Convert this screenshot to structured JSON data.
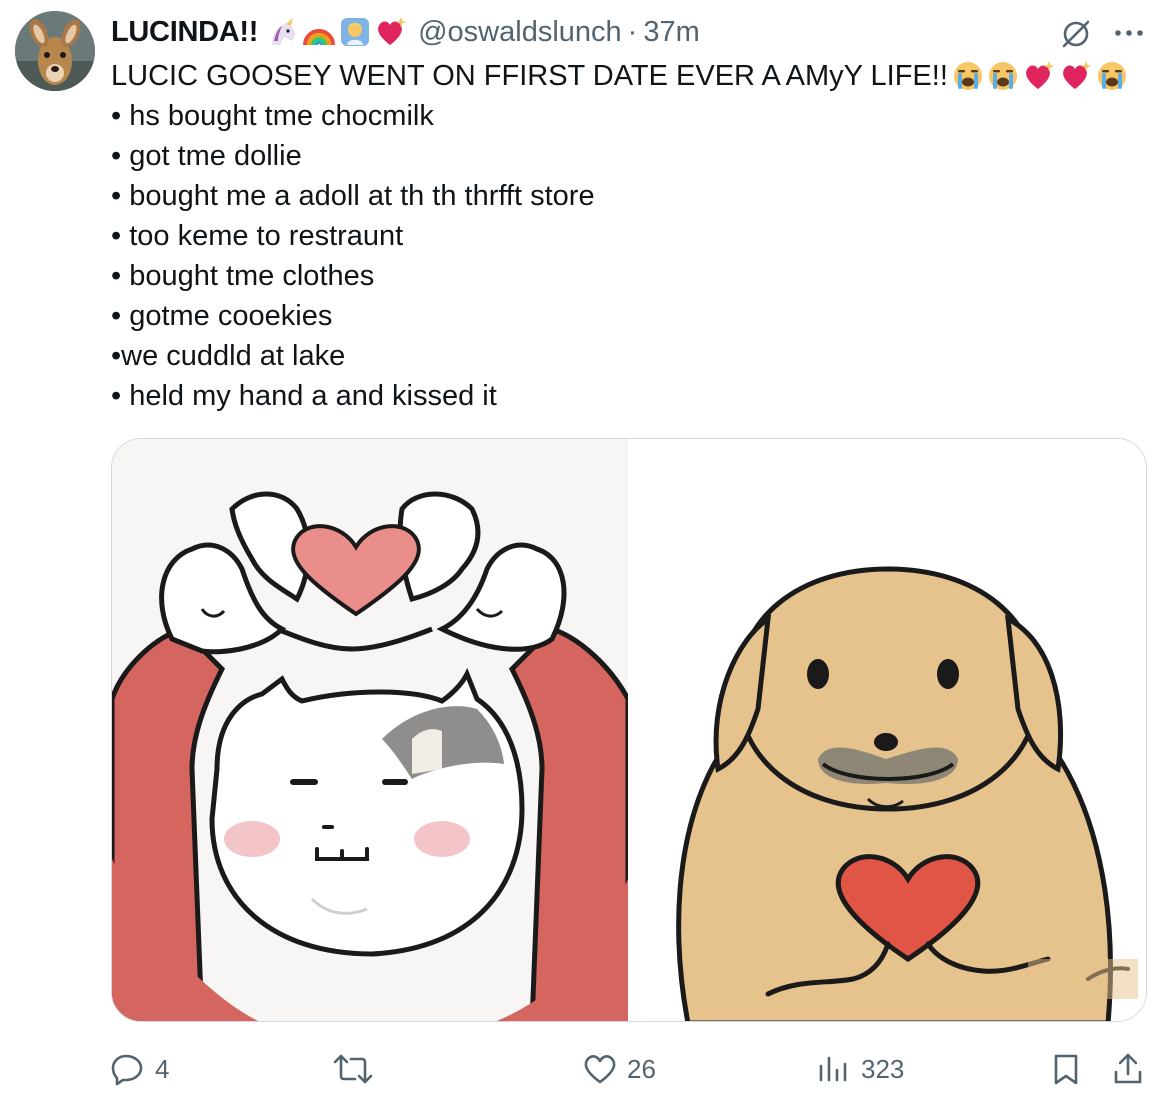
{
  "tweet": {
    "author_name": "LUCINDA!!",
    "name_emojis": [
      "unicorn-emoji",
      "rainbow-emoji",
      "person-in-frame-emoji",
      "sparkling-heart-emoji"
    ],
    "handle": "@oswaldslunch",
    "separator": "·",
    "time": "37m",
    "title": "LUCIC GOOSEY WENT ON FFIRST DATE EVER A AMyY LIFE!!",
    "title_emojis": [
      "loudly-crying-face-emoji",
      "loudly-crying-face-emoji",
      "sparkling-heart-emoji",
      "sparkling-heart-emoji",
      "loudly-crying-face-emoji"
    ],
    "lines": [
      "• hs bought tme chocmilk",
      "• got tme dollie",
      "• bought me a adoll at th th thrfft store",
      "• too keme to restraunt",
      "• bought tme clothes",
      "• gotme cooekies",
      "•we cuddld at lake",
      "• held my hand a and kissed it"
    ]
  },
  "media": {
    "images": [
      {
        "name": "cat-heart-hands-image",
        "subject": "cat-making-heart-with-hands"
      },
      {
        "name": "dog-holding-heart-image",
        "subject": "dog-holding-heart"
      }
    ]
  },
  "actions": {
    "reply_count": "4",
    "retweet_count": "",
    "like_count": "26",
    "views_count": "323"
  },
  "colors": {
    "text": "#0f1419",
    "secondary": "#536471",
    "border": "#cfd9de"
  }
}
